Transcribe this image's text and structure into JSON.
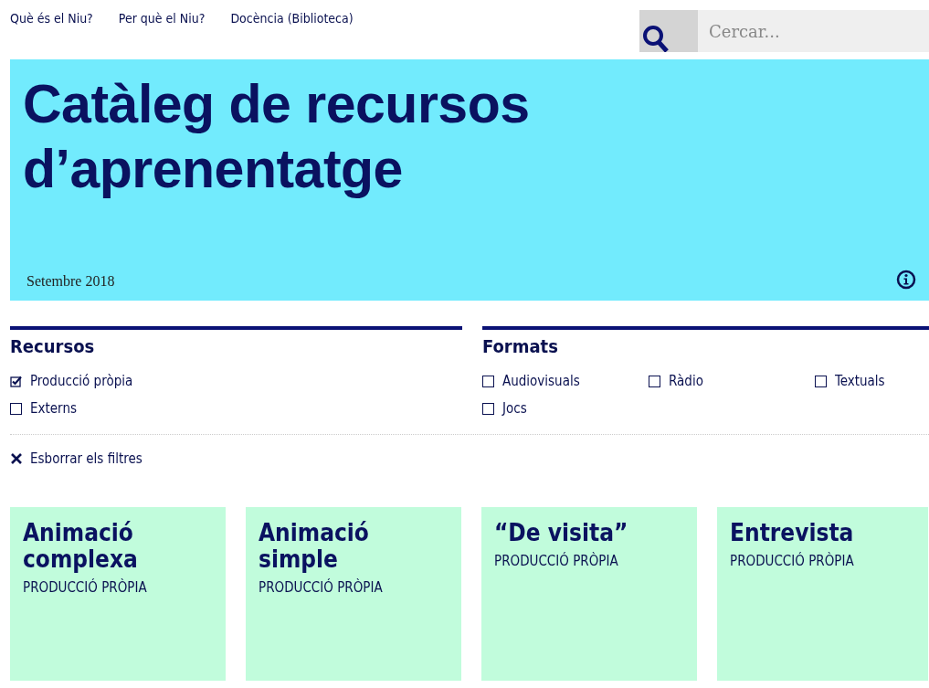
{
  "nav": [
    "Què és el Niu?",
    "Per què el Niu?",
    "Docència (Biblioteca)"
  ],
  "search": {
    "placeholder": "Cercar..."
  },
  "hero": {
    "title_lines": [
      "Catàleg de recursos",
      "d’aprenentatge"
    ],
    "date": "Setembre 2018"
  },
  "filters": [
    {
      "title": "Recursos",
      "options": [
        {
          "label": "Producció pròpia",
          "checked": true
        },
        {
          "label": "Externs",
          "checked": false
        }
      ]
    },
    {
      "title": "Formats",
      "options": [
        {
          "label": "Audiovisuals",
          "checked": false
        },
        {
          "label": "Ràdio",
          "checked": false
        },
        {
          "label": "Textuals",
          "checked": false
        },
        {
          "label": "Jocs",
          "checked": false
        }
      ]
    }
  ],
  "clear_filters": "Esborrar els filtres",
  "cards": [
    {
      "title": "Animació complexa",
      "source": "PRODUCCIÓ PRÒPIA"
    },
    {
      "title": "Animació simple",
      "source": "PRODUCCIÓ PRÒPIA"
    },
    {
      "title": "“De visita”",
      "source": "PRODUCCIÓ PRÒPIA"
    },
    {
      "title": "Entrevista",
      "source": "PRODUCCIÓ PRÒPIA"
    }
  ]
}
